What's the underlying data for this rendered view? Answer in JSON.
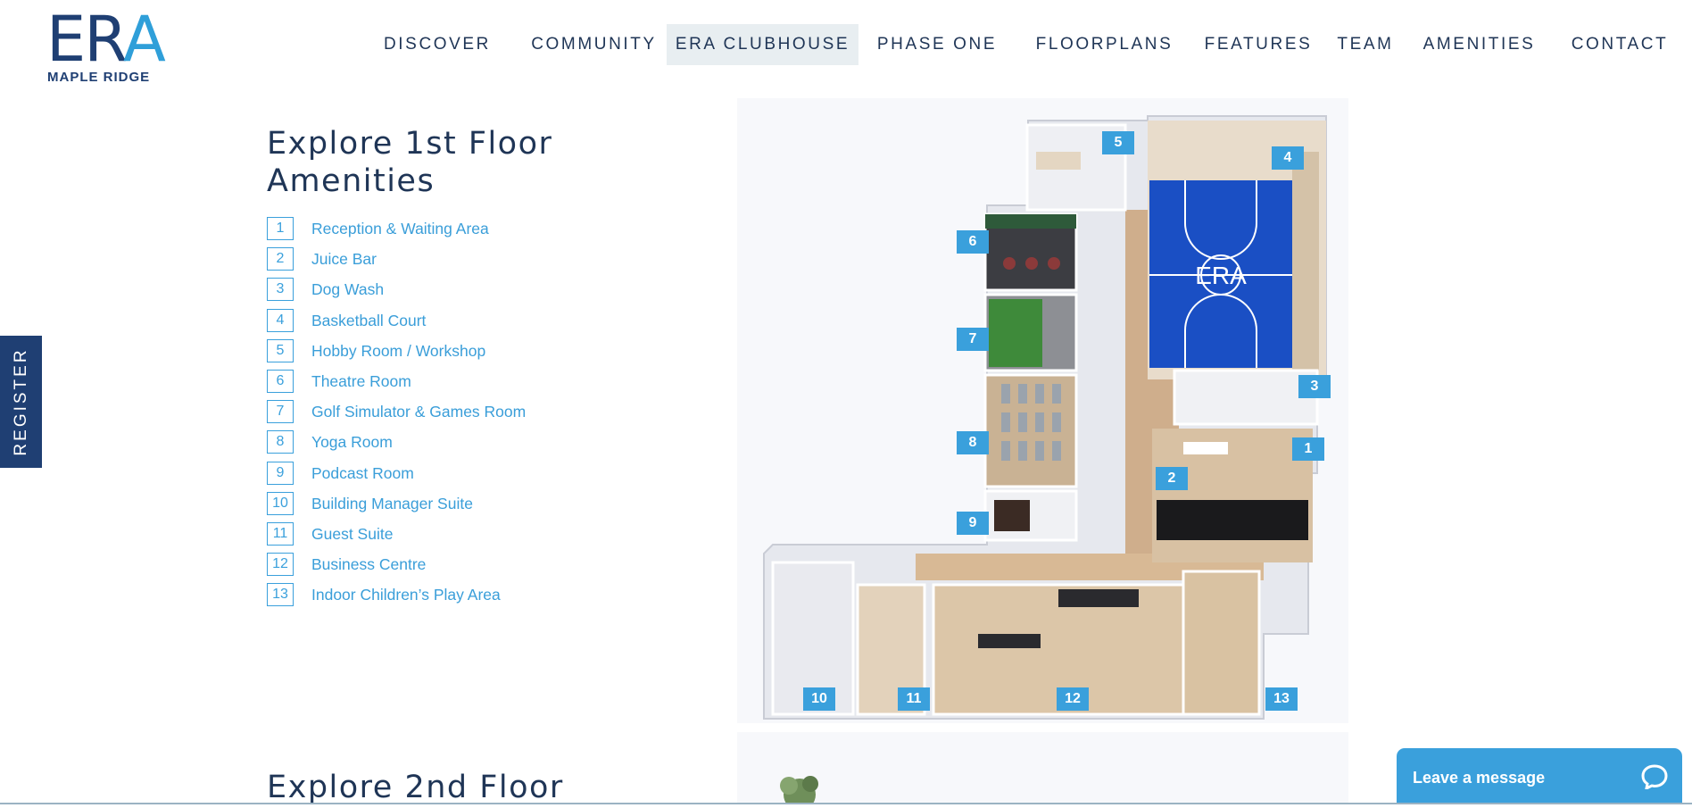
{
  "logo": {
    "main": "ER",
    "accent": "A",
    "sub": "MAPLE RIDGE"
  },
  "nav": {
    "items": [
      {
        "label": "DISCOVER",
        "active": false
      },
      {
        "label": "COMMUNITY",
        "active": false
      },
      {
        "label": "ERA CLUBHOUSE",
        "active": true
      },
      {
        "label": "PHASE ONE",
        "active": false
      },
      {
        "label": "FLOORPLANS",
        "active": false
      },
      {
        "label": "FEATURES",
        "active": false
      },
      {
        "label": "TEAM",
        "active": false
      },
      {
        "label": "AMENITIES",
        "active": false
      },
      {
        "label": "CONTACT",
        "active": false
      }
    ]
  },
  "register": {
    "label": "REGISTER"
  },
  "section1": {
    "title": "Explore 1st Floor Amenities",
    "amenities": [
      {
        "num": "1",
        "label": "Reception & Waiting Area"
      },
      {
        "num": "2",
        "label": "Juice Bar"
      },
      {
        "num": "3",
        "label": "Dog Wash"
      },
      {
        "num": "4",
        "label": "Basketball Court"
      },
      {
        "num": "5",
        "label": "Hobby Room / Workshop"
      },
      {
        "num": "6",
        "label": "Theatre Room"
      },
      {
        "num": "7",
        "label": "Golf Simulator & Games Room"
      },
      {
        "num": "8",
        "label": "Yoga Room"
      },
      {
        "num": "9",
        "label": "Podcast Room"
      },
      {
        "num": "10",
        "label": "Building Manager Suite"
      },
      {
        "num": "11",
        "label": "Guest Suite"
      },
      {
        "num": "12",
        "label": "Business Centre"
      },
      {
        "num": "13",
        "label": "Indoor Children’s Play Area"
      }
    ]
  },
  "floorplan": {
    "court_text": "ERA",
    "markers": [
      "1",
      "2",
      "3",
      "4",
      "5",
      "6",
      "7",
      "8",
      "9",
      "10",
      "11",
      "12",
      "13"
    ]
  },
  "section2": {
    "title": "Explore 2nd Floor"
  },
  "chat": {
    "label": "Leave a message",
    "icon": "chat-bubble-icon"
  },
  "colors": {
    "navy": "#1f3f73",
    "accent": "#3aa0dc",
    "court": "#1a4fc4"
  }
}
